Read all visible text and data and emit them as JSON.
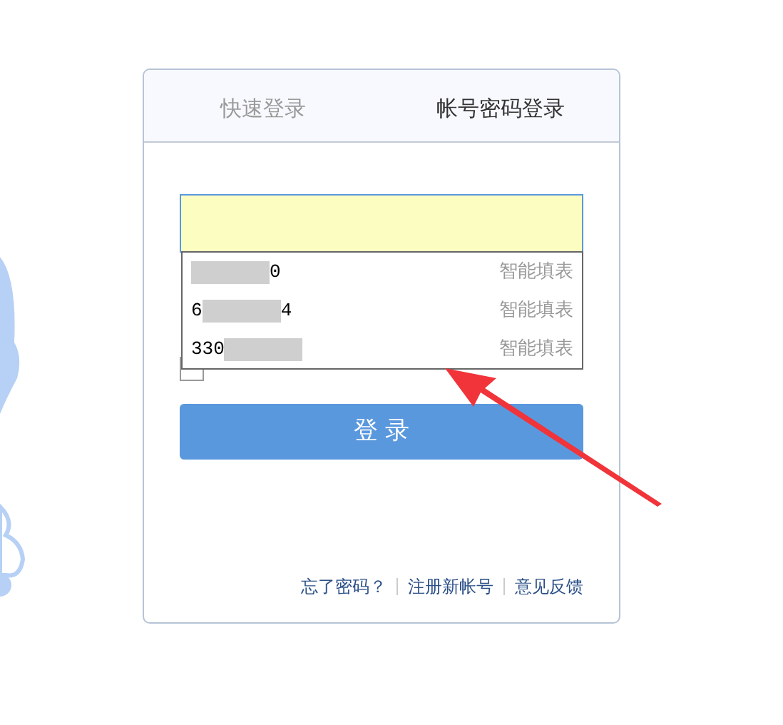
{
  "tabs": [
    {
      "label": "快速登录",
      "selected": false
    },
    {
      "label": "帐号密码登录",
      "selected": true
    }
  ],
  "remember": {
    "checked": false
  },
  "suggestions": [
    {
      "after": "0",
      "action": "智能填表"
    },
    {
      "before": "6",
      "after": "4",
      "action": "智能填表"
    },
    {
      "before": "330",
      "action": "智能填表"
    }
  ],
  "login_button": "登 录",
  "footer_links": [
    "忘了密码？",
    "注册新帐号",
    "意见反馈"
  ]
}
